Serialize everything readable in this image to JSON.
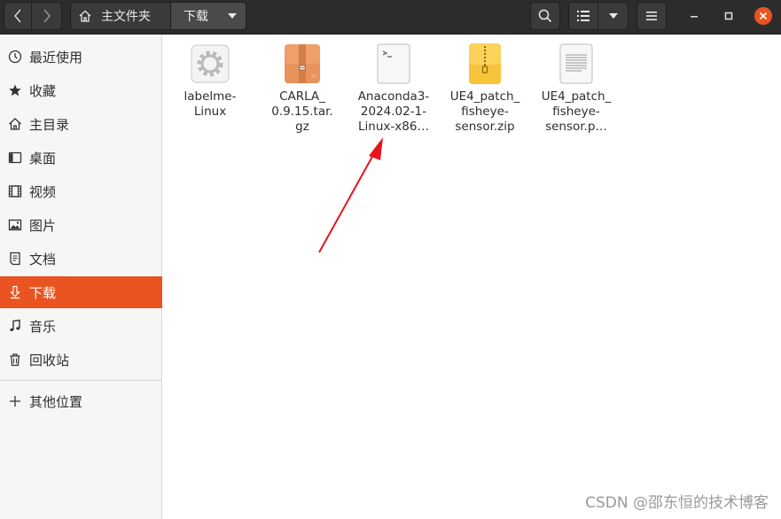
{
  "headerbar": {
    "path_home_label": "主文件夹",
    "path_current_label": "下载"
  },
  "sidebar": {
    "items": [
      {
        "label": "最近使用",
        "icon": "clock-icon"
      },
      {
        "label": "收藏",
        "icon": "star-icon"
      },
      {
        "label": "主目录",
        "icon": "home-icon"
      },
      {
        "label": "桌面",
        "icon": "desktop-icon"
      },
      {
        "label": "视频",
        "icon": "film-icon"
      },
      {
        "label": "图片",
        "icon": "picture-icon"
      },
      {
        "label": "文档",
        "icon": "document-icon"
      },
      {
        "label": "下载",
        "icon": "download-icon",
        "active": true
      },
      {
        "label": "音乐",
        "icon": "music-icon"
      },
      {
        "label": "回收站",
        "icon": "trash-icon"
      },
      {
        "label": "其他位置",
        "icon": "plus-icon"
      }
    ]
  },
  "files": [
    {
      "name": "labelme-\nLinux",
      "icon": "executable-gear-icon"
    },
    {
      "name": "CARLA_\n0.9.15.tar.\ngz",
      "icon": "archive-icon"
    },
    {
      "name": "Anaconda3-\n2024.02-1-\nLinux-x86…",
      "icon": "terminal-script-icon"
    },
    {
      "name": "UE4_patch_\nfisheye-\nsensor.zip",
      "icon": "zip-icon"
    },
    {
      "name": "UE4_patch_\nfisheye-\nsensor.p…",
      "icon": "text-file-icon"
    }
  ],
  "watermark": "CSDN @邵东恒的技术博客",
  "colors": {
    "accent": "#e95420",
    "headerbar": "#2c2c2c",
    "arrow": "#e8141c"
  }
}
